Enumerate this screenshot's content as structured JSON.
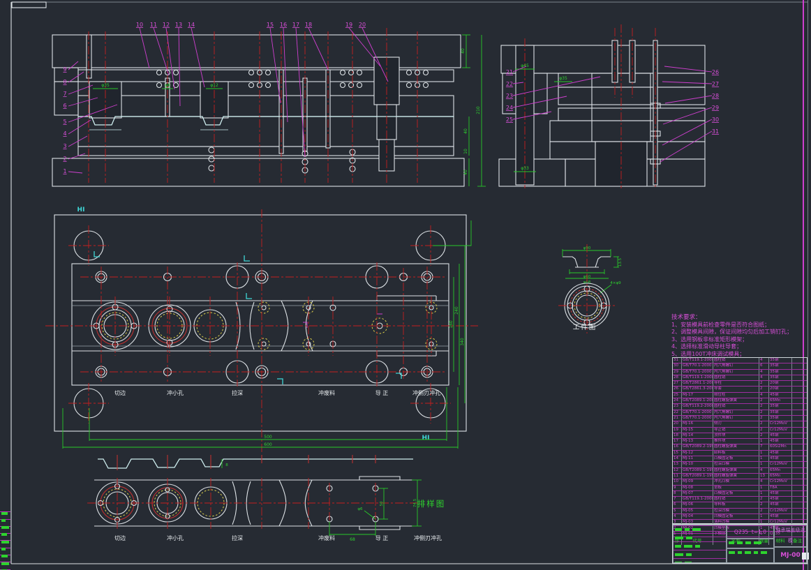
{
  "part_numbers": {
    "left": [
      "9",
      "8",
      "7",
      "6",
      "5",
      "4",
      "3",
      "2",
      "1"
    ],
    "top_a": [
      "10",
      "11",
      "12",
      "13",
      "14"
    ],
    "top_b": [
      "15",
      "16",
      "17",
      "18"
    ],
    "top_c": [
      "19",
      "20"
    ],
    "right_left": [
      "21",
      "22",
      "23",
      "24",
      "25"
    ],
    "right_right": [
      "26",
      "27",
      "28",
      "29",
      "30",
      "31"
    ]
  },
  "dims": {
    "sec1": {
      "phi1": "φ35",
      "phi2": "φ8",
      "phi3": "φ12",
      "h_top": "40",
      "h_all": "210",
      "h_die": "40",
      "h_plate": "10",
      "h_shoe": "40"
    },
    "sec2": {
      "phi_top": "φ45",
      "phi_mid": "φ35",
      "phi_bot": "φ33"
    },
    "plan": {
      "w_inner": "500",
      "w_outer": "600",
      "v1": "160",
      "v2": "240",
      "v3": "340"
    },
    "strip": {
      "pitch": "68",
      "span": "50",
      "hole": "φ6",
      "width": "74.5",
      "depth": "8"
    },
    "work": {
      "d_top": "φ90",
      "h": "13.5",
      "d1": "φ60",
      "d2": "φ68",
      "holes": "4×φ9"
    }
  },
  "labels": {
    "strip_title": "排样图",
    "work_title": "工件图",
    "hi_top": "HI",
    "hi_bottom": "HI"
  },
  "stations": [
    "切边",
    "冲小孔",
    "拉深",
    "冲废料",
    "导 正",
    "冲侧刃冲孔"
  ],
  "tech": {
    "title": "技术要求：",
    "items": [
      "1、安装模具前检查零件是否符合图纸；",
      "2、调整模具间隙，保证间隙均匀后加工销钉孔；",
      "3、选用钢板非标准矩形模架；",
      "4、选择标准滑动导柱导套；",
      "5、选用100T冲床调试模具；"
    ]
  },
  "bom": {
    "headers": [
      "序号",
      "代号",
      "名称",
      "数量",
      "材料",
      "备注"
    ],
    "rows": [
      {
        "no": "31",
        "code": "GB/T119.1-2000",
        "name": "圆柱销",
        "qty": "4",
        "mat": "35钢",
        "note": ""
      },
      {
        "no": "30",
        "code": "GB/T70.1-2000",
        "name": "内六角螺钉",
        "qty": "6",
        "mat": "35钢",
        "note": ""
      },
      {
        "no": "29",
        "code": "GB/T70.1-2000",
        "name": "内六角螺钉",
        "qty": "4",
        "mat": "35钢",
        "note": ""
      },
      {
        "no": "28",
        "code": "GB/T119.1-2000",
        "name": "圆柱销",
        "qty": "4",
        "mat": "35钢",
        "note": ""
      },
      {
        "no": "27",
        "code": "GB/T2861.1-2008",
        "name": "导柱",
        "qty": "2",
        "mat": "20钢",
        "note": ""
      },
      {
        "no": "26",
        "code": "GB/T2861.3-2008",
        "name": "导套",
        "qty": "2",
        "mat": "20钢",
        "note": ""
      },
      {
        "no": "25",
        "code": "MJ-17",
        "name": "限位柱",
        "qty": "4",
        "mat": "45钢",
        "note": ""
      },
      {
        "no": "24",
        "code": "GB/T2089.1-2009",
        "name": "圆柱螺旋弹簧",
        "qty": "2",
        "mat": "65Mn",
        "note": ""
      },
      {
        "no": "23",
        "code": "GB/T119.2-2000",
        "name": "圆柱销",
        "qty": "2",
        "mat": "35钢",
        "note": ""
      },
      {
        "no": "22",
        "code": "GB/T70.1-2000",
        "name": "内六角螺钉",
        "qty": "2",
        "mat": "35钢",
        "note": ""
      },
      {
        "no": "21",
        "code": "GB/T70.1-2000",
        "name": "内六角螺钉",
        "qty": "2",
        "mat": "35钢",
        "note": ""
      },
      {
        "no": "20",
        "code": "MJ-16",
        "name": "侧刃",
        "qty": "2",
        "mat": "Cr12MoV",
        "note": ""
      },
      {
        "no": "19",
        "code": "MJ-15",
        "name": "导正销",
        "qty": "2",
        "mat": "Cr12MoV",
        "note": ""
      },
      {
        "no": "18",
        "code": "MJ-14",
        "name": "顶件块",
        "qty": "2",
        "mat": "45钢",
        "note": ""
      },
      {
        "no": "17",
        "code": "MJ-13",
        "name": "推件块",
        "qty": "1",
        "mat": "45钢",
        "note": ""
      },
      {
        "no": "16",
        "code": "GB/T2089.2-1994",
        "name": "圆柱螺旋弹簧",
        "qty": "7",
        "mat": "60Si2Mn",
        "note": ""
      },
      {
        "no": "15",
        "code": "MJ-12",
        "name": "卸料板",
        "qty": "1",
        "mat": "45钢",
        "note": ""
      },
      {
        "no": "14",
        "code": "MJ-11",
        "name": "凸模固定板",
        "qty": "1",
        "mat": "45钢",
        "note": ""
      },
      {
        "no": "13",
        "code": "MJ-10",
        "name": "拉深凸模",
        "qty": "1",
        "mat": "Cr12MoV",
        "note": ""
      },
      {
        "no": "12",
        "code": "GB/T2089.1-1994",
        "name": "圆柱螺旋弹簧",
        "qty": "4",
        "mat": "65Mn",
        "note": ""
      },
      {
        "no": "11",
        "code": "GB/T2089.1-1994",
        "name": "圆柱螺旋弹簧",
        "qty": "13",
        "mat": "65Mn",
        "note": ""
      },
      {
        "no": "10",
        "code": "MJ-09",
        "name": "冲孔凸模",
        "qty": "4",
        "mat": "Cr12MoV",
        "note": ""
      },
      {
        "no": "9",
        "code": "MJ-08",
        "name": "垫板",
        "qty": "1",
        "mat": "T8A",
        "note": ""
      },
      {
        "no": "8",
        "code": "MJ-07",
        "name": "凸模固定板",
        "qty": "1",
        "mat": "45钢",
        "note": ""
      },
      {
        "no": "7",
        "code": "GB/T119.1-2000",
        "name": "圆柱销",
        "qty": "2",
        "mat": "45钢",
        "note": ""
      },
      {
        "no": "6",
        "code": "MJ-06",
        "name": "导料板",
        "qty": "2",
        "mat": "45钢",
        "note": ""
      },
      {
        "no": "5",
        "code": "MJ-05",
        "name": "拉深凹模",
        "qty": "2",
        "mat": "Cr12MoV",
        "note": ""
      },
      {
        "no": "4",
        "code": "MJ-04",
        "name": "凹模固定板",
        "qty": "1",
        "mat": "45钢",
        "note": ""
      },
      {
        "no": "3",
        "code": "MJ-03",
        "name": "落料凹模",
        "qty": "1",
        "mat": "Cr12MoV",
        "note": ""
      },
      {
        "no": "2",
        "code": "MJ-02",
        "name": "凹模垫板",
        "qty": "1",
        "mat": "45钢",
        "note": ""
      },
      {
        "no": "1",
        "code": "MJ-01",
        "name": "下模座",
        "qty": "1",
        "mat": "Q235",
        "note": ""
      }
    ]
  },
  "titleblock": {
    "material": "Q235",
    "thickness": "t=1.0",
    "title": "轴承端盖级进模",
    "drawing_no": "MJ-00"
  }
}
